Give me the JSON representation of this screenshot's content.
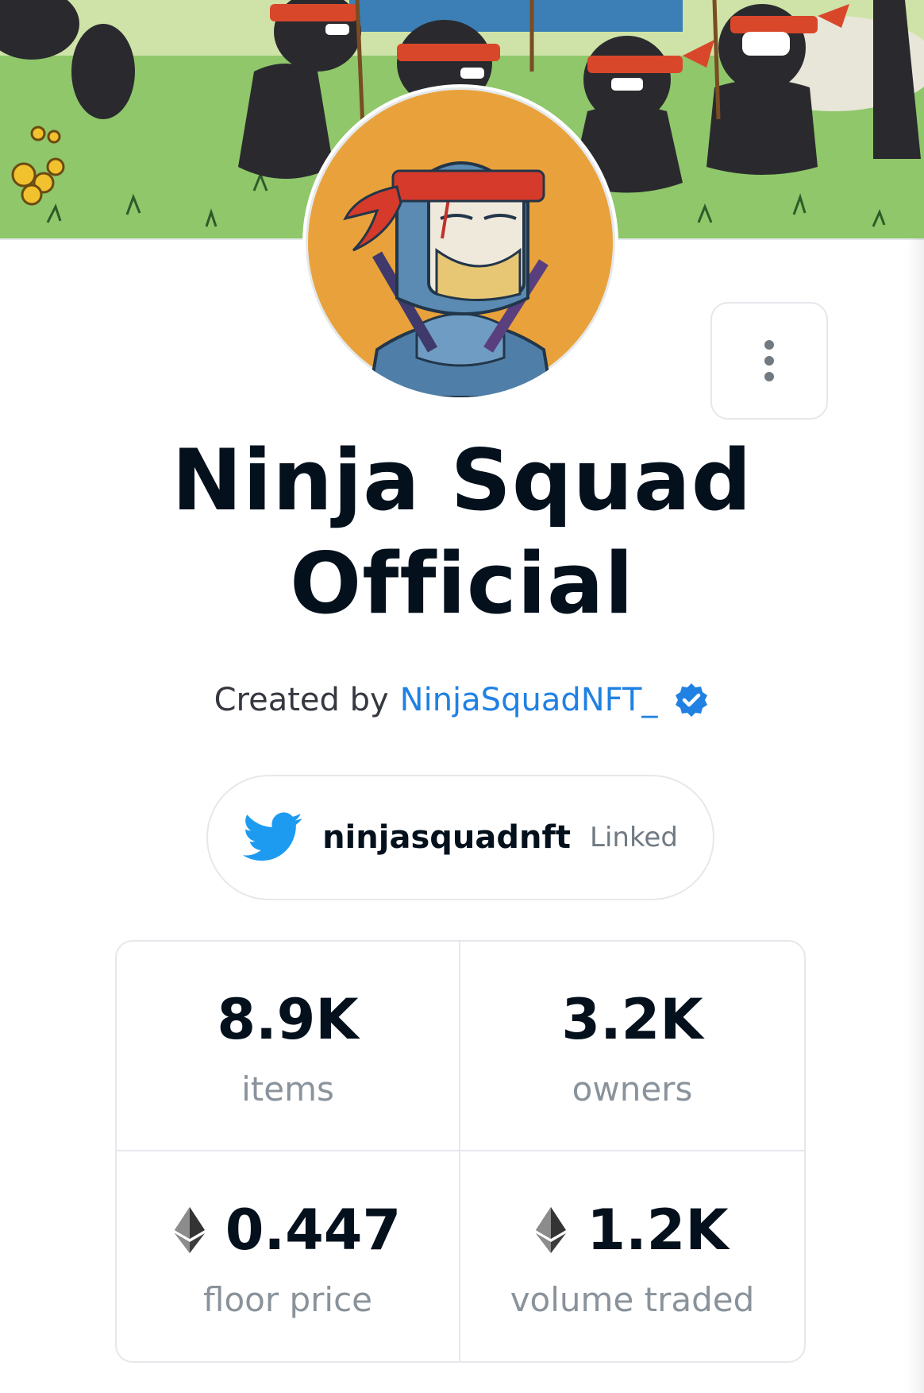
{
  "collection": {
    "title_line1": "Ninja Squad",
    "title_line2": "Official",
    "created_by_prefix": "Created by",
    "creator_name": "NinjaSquadNFT_",
    "creator_verified_icon": "verified-badge-icon",
    "more_icon": "vertical-dots-icon"
  },
  "twitter": {
    "icon": "twitter-bird-icon",
    "handle": "ninjasquadnft",
    "status": "Linked"
  },
  "stats": [
    {
      "value": "8.9K",
      "label": "items",
      "icon": ""
    },
    {
      "value": "3.2K",
      "label": "owners",
      "icon": ""
    },
    {
      "value": "0.447",
      "label": "floor price",
      "icon": "ethereum-icon"
    },
    {
      "value": "1.2K",
      "label": "volume traded",
      "icon": "ethereum-icon"
    }
  ],
  "colors": {
    "link": "#2081e2",
    "text_primary": "#04111d",
    "text_secondary": "#8a939b",
    "border": "#e5e8eb",
    "twitter": "#1d9bf0",
    "avatar_bg": "#e9a23b"
  }
}
